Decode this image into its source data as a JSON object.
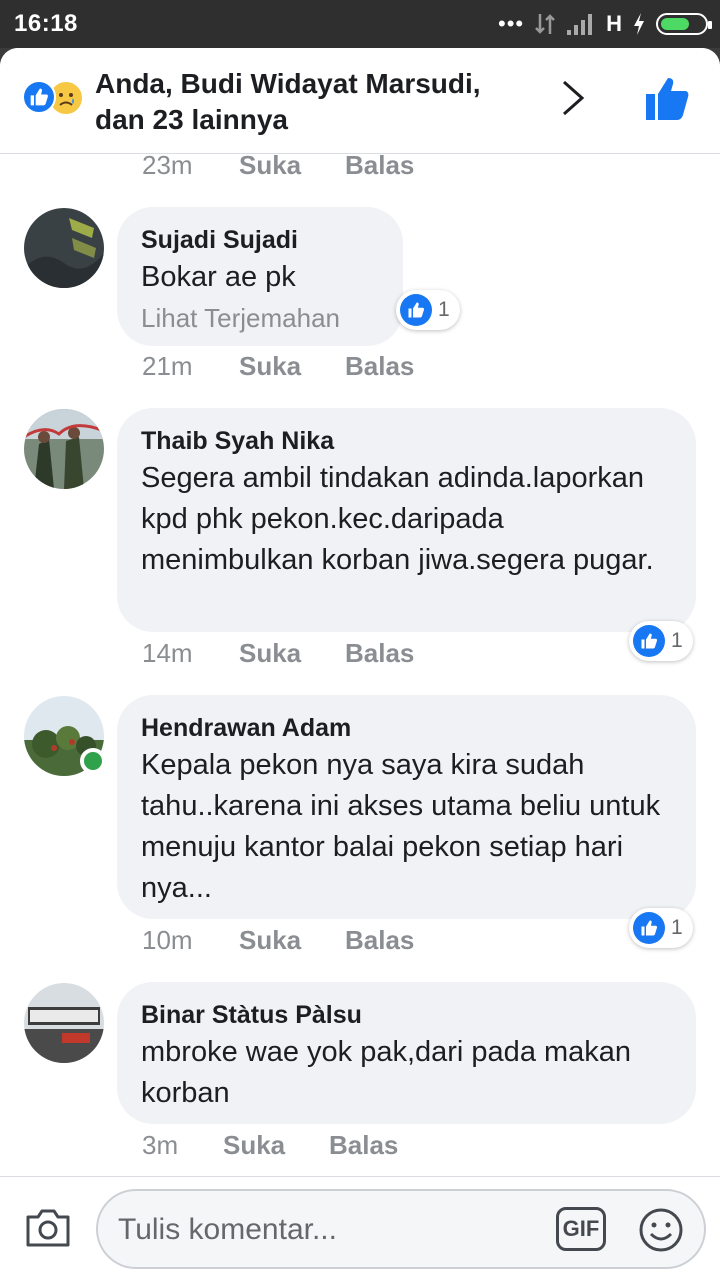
{
  "status_bar": {
    "time": "16:18",
    "network": "H",
    "dots": "•••"
  },
  "header": {
    "title": "Anda, Budi Widayat Marsudi, dan 23 lainnya",
    "reaction_icons": [
      "like-icon",
      "sad-face-icon"
    ]
  },
  "top_meta": {
    "time": "23m",
    "like": "Suka",
    "reply": "Balas"
  },
  "comments": [
    {
      "author": "Sujadi Sujadi",
      "text": "Bokar ae pk",
      "translate": "Lihat Terjemahan",
      "time": "21m",
      "like": "Suka",
      "reply": "Balas",
      "reactions": "1"
    },
    {
      "author": "Thaib Syah Nika",
      "text": "Segera ambil tindakan adinda.laporkan kpd phk pekon.kec.daripada menimbulkan korban jiwa.segera pugar.",
      "time": "14m",
      "like": "Suka",
      "reply": "Balas",
      "reactions": "1"
    },
    {
      "author": "Hendrawan Adam",
      "text": "Kepala pekon nya saya kira sudah tahu..karena ini akses utama beliu untuk menuju kantor balai pekon setiap hari nya...",
      "time": "10m",
      "like": "Suka",
      "reply": "Balas",
      "reactions": "1",
      "online": true
    },
    {
      "author": "Binar Stàtus Pàlsu",
      "text": "mbroke wae yok pak,dari pada makan korban",
      "time": "3m",
      "like": "Suka",
      "reply": "Balas"
    }
  ],
  "composer": {
    "placeholder": "Tulis komentar...",
    "gif_label": "GIF"
  },
  "colors": {
    "accent": "#1877f2",
    "bubble": "#f0f2f5",
    "meta": "#8a8d91",
    "online": "#31a24c"
  }
}
